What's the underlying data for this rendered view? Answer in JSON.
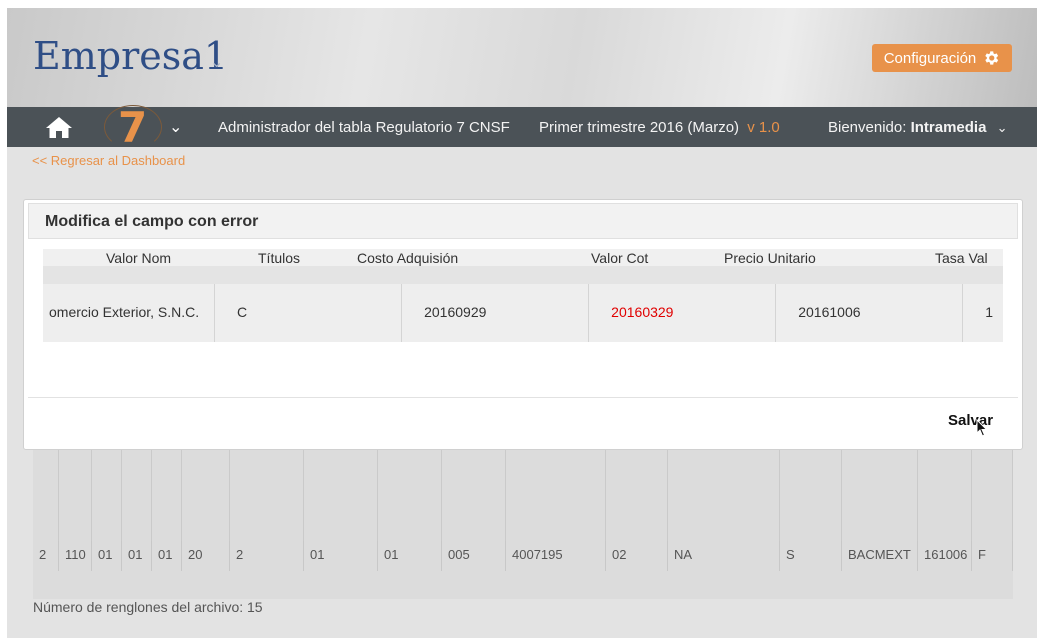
{
  "header": {
    "logo": "Empresa1",
    "config_label": "Configuración"
  },
  "navbar": {
    "badge": "7",
    "admin_title": "Administrador del tabla Regulatorio 7 CNSF",
    "period": "Primer trimestre 2016 (Marzo)",
    "version": "v 1.0",
    "welcome": "Bienvenido:",
    "user": "Intramedia"
  },
  "back_link": "<< Regresar al Dashboard",
  "modal": {
    "title": "Modifica el campo con error",
    "columns": [
      "Valor Nom",
      "Títulos",
      "Costo Adquisión",
      "Valor Cot",
      "Precio Unitario",
      "Tasa Val"
    ],
    "row": [
      "omercio Exterior, S.N.C.",
      "C",
      "20160929",
      "20160329",
      "20161006",
      "1"
    ],
    "save_label": "Salvar"
  },
  "background_table": {
    "row": [
      "2",
      "110",
      "01",
      "01",
      "01",
      "20",
      "2",
      "01",
      "01",
      "005",
      "4007195",
      "02",
      "NA",
      "S",
      "BACMEXT",
      "161006",
      "F"
    ]
  },
  "row_count": "Número de renglones del archivo: 15",
  "colors": {
    "accent": "#e8924a",
    "navbar": "#4b5257",
    "error": "#e00000",
    "logo": "#2f4e86"
  }
}
